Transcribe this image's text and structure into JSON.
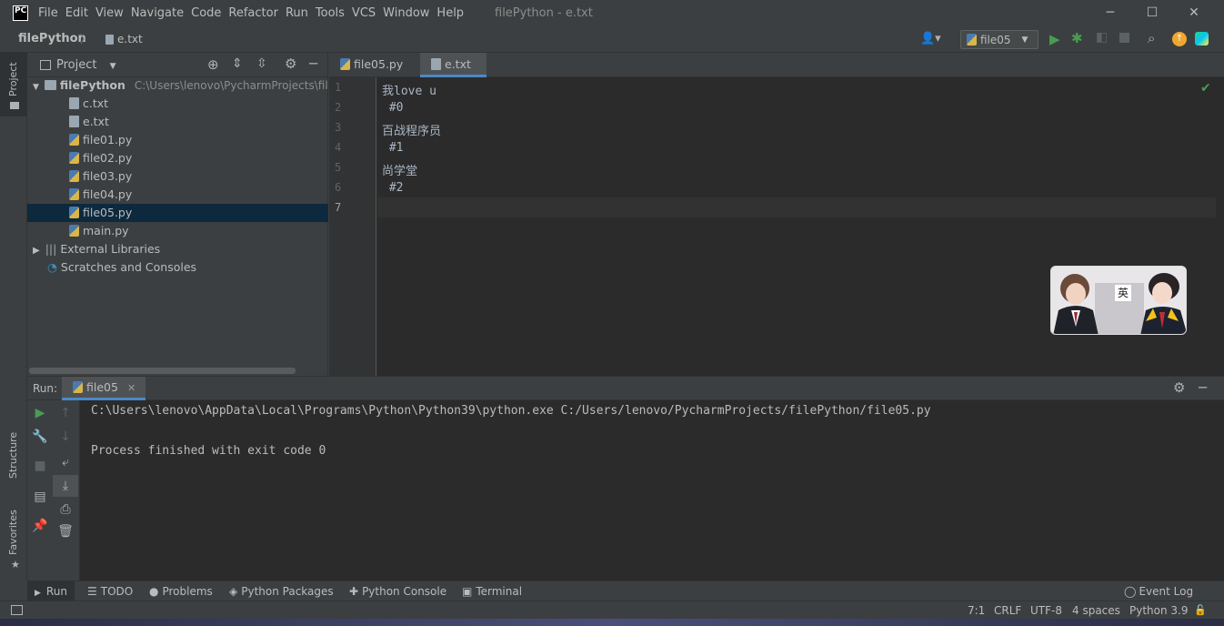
{
  "titlebar": {
    "logo": "PC",
    "menu": [
      "File",
      "Edit",
      "View",
      "Navigate",
      "Code",
      "Refactor",
      "Run",
      "Tools",
      "VCS",
      "Window",
      "Help"
    ],
    "window_title": "filePython - e.txt",
    "minimize": "─",
    "maximize": "☐",
    "close": "✕"
  },
  "navbar": {
    "project": "filePython",
    "file": "e.txt",
    "run_config": "file05"
  },
  "left_stripe": {
    "project": "Project",
    "structure": "Structure",
    "favorites": "Favorites"
  },
  "project_pane": {
    "title": "Project",
    "root": "filePython",
    "root_path": "C:\\Users\\lenovo\\PycharmProjects\\fileP",
    "files": [
      "c.txt",
      "e.txt",
      "file01.py",
      "file02.py",
      "file03.py",
      "file04.py",
      "file05.py",
      "main.py"
    ],
    "selected_file": "file05.py",
    "external_libraries": "External Libraries",
    "scratches": "Scratches and Consoles"
  },
  "editor": {
    "tabs": [
      {
        "label": "file05.py",
        "active": false
      },
      {
        "label": "e.txt",
        "active": true
      }
    ],
    "lines": [
      "我love u",
      " #0",
      "百战程序员",
      " #1",
      "尚学堂",
      " #2",
      ""
    ],
    "line_numbers": [
      "1",
      "2",
      "3",
      "4",
      "5",
      "6",
      "7"
    ],
    "photo_caption": "英"
  },
  "run_window": {
    "label": "Run:",
    "tab": "file05",
    "console": [
      "C:\\Users\\lenovo\\AppData\\Local\\Programs\\Python\\Python39\\python.exe C:/Users/lenovo/PycharmProjects/filePython/file05.py",
      "",
      "Process finished with exit code 0"
    ]
  },
  "bottom_tools": {
    "run": "Run",
    "todo": "TODO",
    "problems": "Problems",
    "python_packages": "Python Packages",
    "python_console": "Python Console",
    "terminal": "Terminal",
    "event_log": "Event Log"
  },
  "statusbar": {
    "position": "7:1",
    "line_sep": "CRLF",
    "encoding": "UTF-8",
    "indent": "4 spaces",
    "interpreter": "Python 3.9"
  },
  "colors": {
    "bg": "#3c3f41",
    "editor_bg": "#2b2b2b",
    "accent": "#4a88c7",
    "run_green": "#499c54"
  }
}
